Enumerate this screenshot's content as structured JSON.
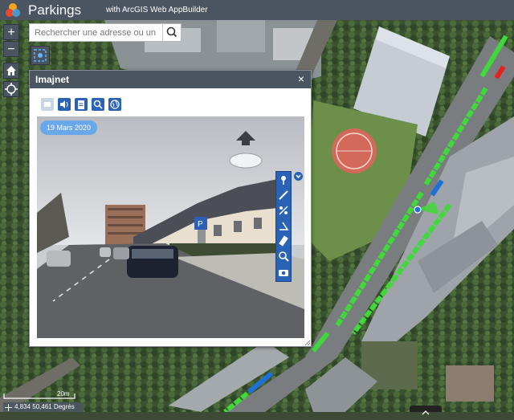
{
  "header": {
    "title": "Parkings",
    "subtitle": "with ArcGIS Web AppBuilder"
  },
  "search": {
    "placeholder": "Rechercher une adresse ou un lie"
  },
  "zoom": {
    "in_label": "+",
    "out_label": "−"
  },
  "panel": {
    "title": "Imajnet",
    "close_label": "×",
    "date_badge": "19 Mars 2020",
    "tools": [
      "screen-icon",
      "speaker-icon",
      "clipboard-icon",
      "zoom-search-icon",
      "globe-icon"
    ],
    "side_tools": [
      "pin-icon",
      "measure-icon",
      "compass-icon",
      "angle-icon",
      "ruler-icon",
      "magnifier-icon",
      "camera-icon"
    ]
  },
  "status": {
    "scale_label": "20m",
    "coordinates": "4,834 50,461 Degrés"
  },
  "colors": {
    "header": "#4a5561",
    "accent_blue": "#2a62b5",
    "parking_free": "#3fd93a",
    "parking_occupied": "#e3231f",
    "parking_reserved": "#1f6fd8"
  }
}
